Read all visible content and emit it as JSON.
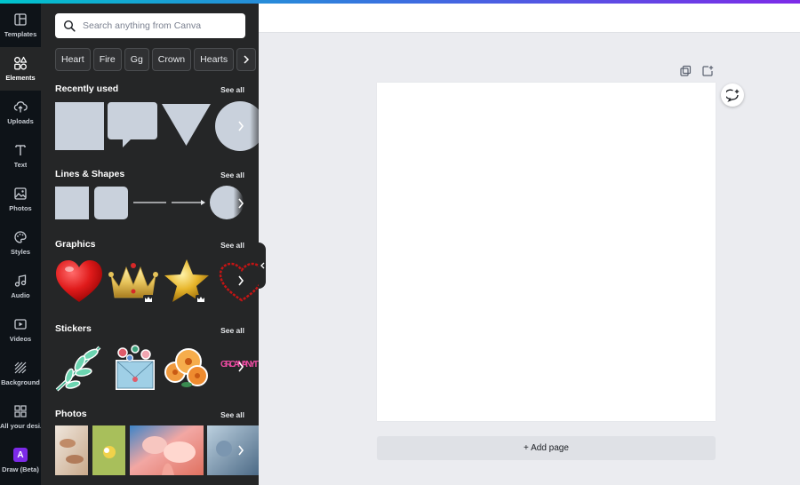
{
  "rail": {
    "items": [
      {
        "label": "Templates",
        "icon": "templates-icon"
      },
      {
        "label": "Elements",
        "icon": "elements-icon"
      },
      {
        "label": "Uploads",
        "icon": "upload-cloud-icon"
      },
      {
        "label": "Text",
        "icon": "text-icon"
      },
      {
        "label": "Photos",
        "icon": "photo-icon"
      },
      {
        "label": "Styles",
        "icon": "palette-icon"
      },
      {
        "label": "Audio",
        "icon": "music-note-icon"
      },
      {
        "label": "Videos",
        "icon": "video-icon"
      },
      {
        "label": "Background",
        "icon": "background-icon"
      },
      {
        "label": "All your desi...",
        "icon": "grid-icon"
      },
      {
        "label": "Draw (Beta)",
        "icon": "draw-icon",
        "badge": "A"
      }
    ]
  },
  "panel": {
    "search_placeholder": "Search anything from Canva",
    "chips": [
      "Heart",
      "Fire",
      "Gg",
      "Crown",
      "Hearts"
    ],
    "sections": {
      "recent": {
        "title": "Recently used",
        "see_all": "See all"
      },
      "lines": {
        "title": "Lines & Shapes",
        "see_all": "See all"
      },
      "graphics": {
        "title": "Graphics",
        "see_all": "See all"
      },
      "stickers": {
        "title": "Stickers",
        "see_all": "See all",
        "sticker_text": "GIR CAN ANYT"
      },
      "photos": {
        "title": "Photos",
        "see_all": "See all"
      }
    }
  },
  "canvas": {
    "add_page": "+ Add page"
  },
  "colors": {
    "rail_bg": "#0e1318",
    "panel_bg": "#252627",
    "shape_fill": "#c9d1dc",
    "canvas_bg": "#ebecf0",
    "accent_purple": "#7d2ae8"
  }
}
